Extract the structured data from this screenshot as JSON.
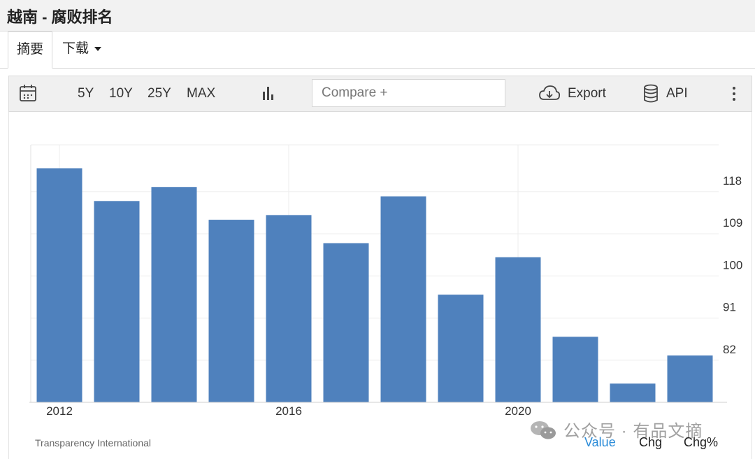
{
  "header": {
    "title": "越南 - 腐败排名"
  },
  "tabs": [
    {
      "label": "摘要"
    },
    {
      "label": "下载"
    }
  ],
  "toolbar": {
    "ranges": [
      "5Y",
      "10Y",
      "25Y",
      "MAX"
    ],
    "compare_placeholder": "Compare +",
    "export_label": "Export",
    "api_label": "API"
  },
  "chart_data": {
    "type": "bar",
    "categories": [
      "2012",
      "2013",
      "2014",
      "2015",
      "2016",
      "2017",
      "2018",
      "2019",
      "2020",
      "2021",
      "2022",
      "2023"
    ],
    "values": [
      123,
      116,
      119,
      112,
      113,
      107,
      117,
      96,
      104,
      87,
      77,
      83
    ],
    "x_tick_labels": [
      "2012",
      "2016",
      "2020"
    ],
    "y_ticks": [
      82,
      91,
      100,
      109,
      118
    ],
    "ylim": [
      73,
      128
    ],
    "color": "#4f81bd",
    "grid": true,
    "y_axis_position": "right"
  },
  "footer": {
    "source": "Transparency International",
    "tabs": [
      "Value",
      "Chg",
      "Chg%"
    ],
    "active_tab": "Value"
  },
  "watermark": "公众号 · 有品文摘"
}
